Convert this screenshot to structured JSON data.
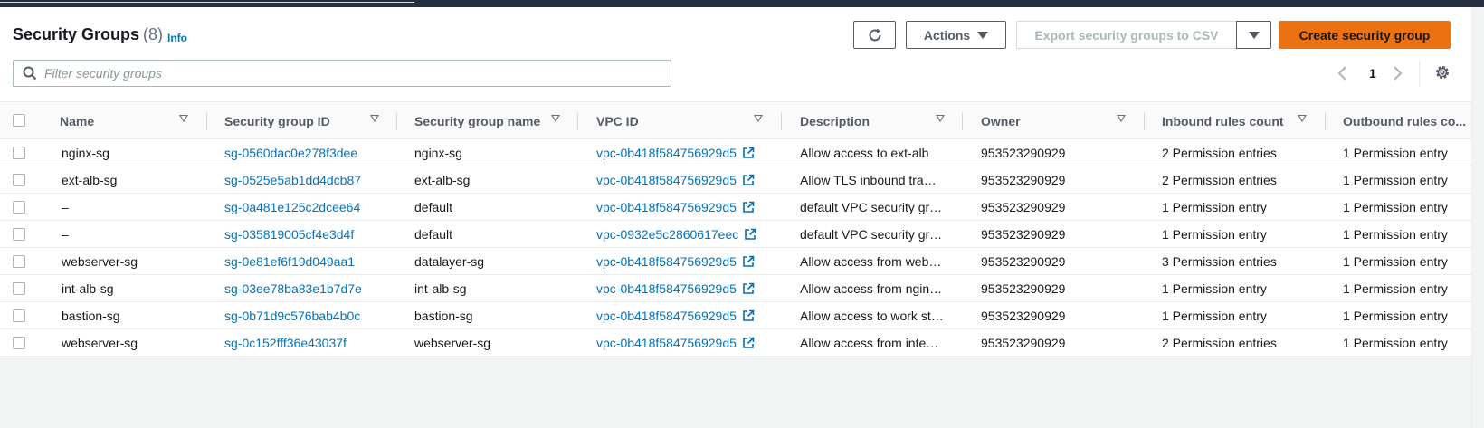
{
  "header": {
    "title": "Security Groups",
    "count": "(8)",
    "info_label": "Info"
  },
  "toolbar": {
    "refresh_icon": "refresh-icon",
    "actions_label": "Actions",
    "export_label": "Export security groups to CSV",
    "create_label": "Create security group"
  },
  "search": {
    "placeholder": "Filter security groups",
    "value": ""
  },
  "pagination": {
    "current_page": "1"
  },
  "columns": [
    {
      "label": "Name"
    },
    {
      "label": "Security group ID"
    },
    {
      "label": "Security group name"
    },
    {
      "label": "VPC ID"
    },
    {
      "label": "Description"
    },
    {
      "label": "Owner"
    },
    {
      "label": "Inbound rules count"
    },
    {
      "label": "Outbound rules co..."
    }
  ],
  "rows": [
    {
      "name": "nginx-sg",
      "sg_id": "sg-0560dac0e278f3dee",
      "sg_name": "nginx-sg",
      "vpc_id": "vpc-0b418f584756929d5",
      "description": "Allow access to ext-alb",
      "owner": "953523290929",
      "inbound": "2 Permission entries",
      "outbound": "1 Permission entry"
    },
    {
      "name": "ext-alb-sg",
      "sg_id": "sg-0525e5ab1dd4dcb87",
      "sg_name": "ext-alb-sg",
      "vpc_id": "vpc-0b418f584756929d5",
      "description": "Allow TLS inbound tra…",
      "owner": "953523290929",
      "inbound": "2 Permission entries",
      "outbound": "1 Permission entry"
    },
    {
      "name": "–",
      "sg_id": "sg-0a481e125c2dcee64",
      "sg_name": "default",
      "vpc_id": "vpc-0b418f584756929d5",
      "description": "default VPC security gr…",
      "owner": "953523290929",
      "inbound": "1 Permission entry",
      "outbound": "1 Permission entry"
    },
    {
      "name": "–",
      "sg_id": "sg-035819005cf4e3d4f",
      "sg_name": "default",
      "vpc_id": "vpc-0932e5c2860617eec",
      "description": "default VPC security gr…",
      "owner": "953523290929",
      "inbound": "1 Permission entry",
      "outbound": "1 Permission entry"
    },
    {
      "name": "webserver-sg",
      "sg_id": "sg-0e81ef6f19d049aa1",
      "sg_name": "datalayer-sg",
      "vpc_id": "vpc-0b418f584756929d5",
      "description": "Allow access from web…",
      "owner": "953523290929",
      "inbound": "3 Permission entries",
      "outbound": "1 Permission entry"
    },
    {
      "name": "int-alb-sg",
      "sg_id": "sg-03ee78ba83e1b7d7e",
      "sg_name": "int-alb-sg",
      "vpc_id": "vpc-0b418f584756929d5",
      "description": "Allow access from ngin…",
      "owner": "953523290929",
      "inbound": "1 Permission entry",
      "outbound": "1 Permission entry"
    },
    {
      "name": "bastion-sg",
      "sg_id": "sg-0b71d9c576bab4b0c",
      "sg_name": "bastion-sg",
      "vpc_id": "vpc-0b418f584756929d5",
      "description": "Allow access to work st…",
      "owner": "953523290929",
      "inbound": "1 Permission entry",
      "outbound": "1 Permission entry"
    },
    {
      "name": "webserver-sg",
      "sg_id": "sg-0c152fff36e43037f",
      "sg_name": "webserver-sg",
      "vpc_id": "vpc-0b418f584756929d5",
      "description": "Allow access from inte…",
      "owner": "953523290929",
      "inbound": "2 Permission entries",
      "outbound": "1 Permission entry"
    }
  ],
  "colors": {
    "primary_button": "#ec7211",
    "link": "#0073bb",
    "topbar": "#232f3e"
  }
}
